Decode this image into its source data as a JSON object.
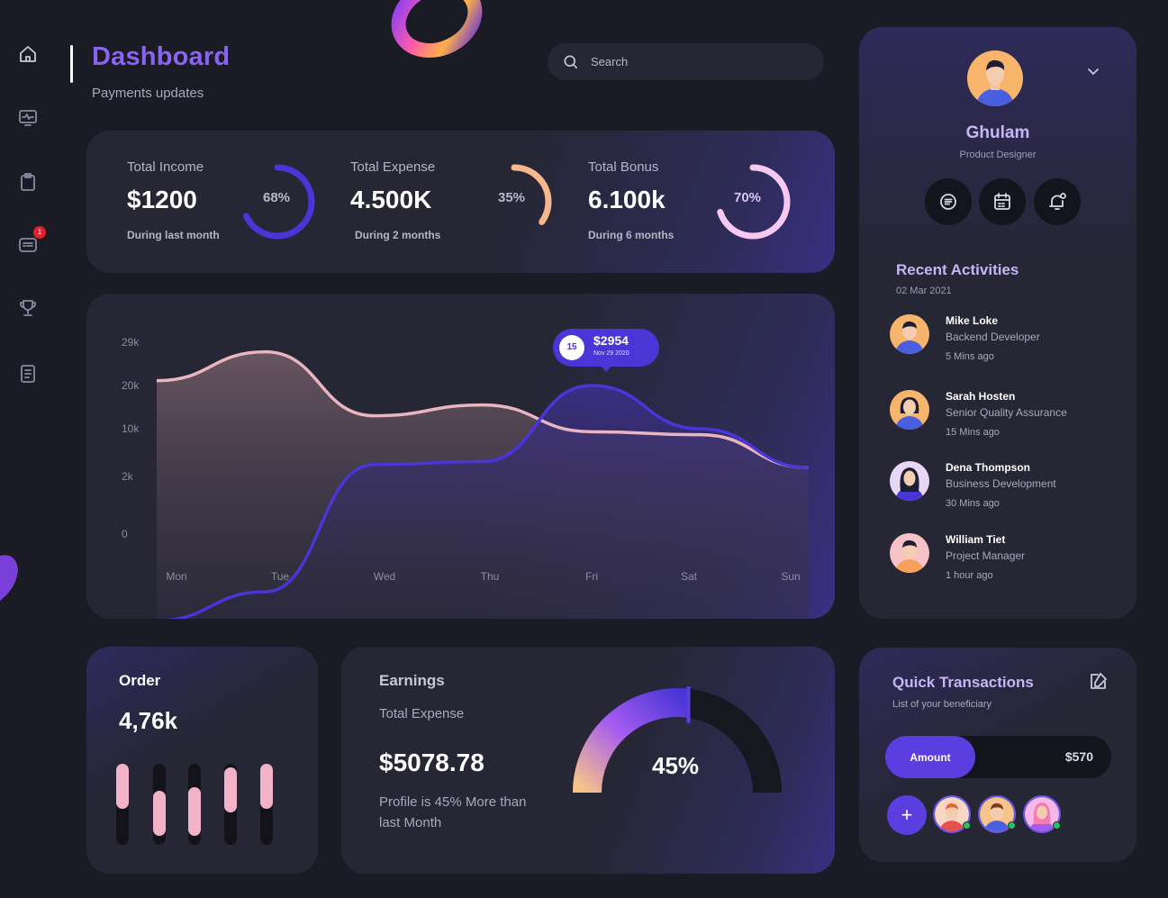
{
  "sidebar": {
    "icons": [
      "home-icon",
      "monitor-icon",
      "clipboard-icon",
      "message-icon",
      "trophy-icon",
      "document-icon"
    ],
    "notification_count": "1"
  },
  "header": {
    "title": "Dashboard",
    "subtitle": "Payments updates"
  },
  "search": {
    "placeholder": "Search"
  },
  "stats": [
    {
      "label": "Total Income",
      "value": "$1200",
      "sub": "During last month",
      "percent_label": "68%",
      "percent": 68,
      "color": "#4a35d6"
    },
    {
      "label": "Total Expense",
      "value": "4.500K",
      "sub": "During 2 months",
      "percent_label": "35%",
      "percent": 35,
      "color": "#f6b78b"
    },
    {
      "label": "Total Bonus",
      "value": "6.100k",
      "sub": "During 6 months",
      "percent_label": "70%",
      "percent": 70,
      "color": "#f7c9f2"
    }
  ],
  "chart_data": {
    "type": "area",
    "categories": [
      "Mon",
      "Tue",
      "Wed",
      "Thu",
      "Fri",
      "Sat",
      "Sun"
    ],
    "y_tick_labels": [
      "0",
      "2k",
      "10k",
      "20k",
      "29k"
    ],
    "series": [
      {
        "color": "#e9b6c0",
        "values": [
          21,
          27,
          13,
          15.5,
          9.5,
          9,
          3.5
        ]
      },
      {
        "color": "#4a35d6",
        "values": [
          -3,
          -2,
          4,
          4.5,
          20,
          10,
          3.5
        ]
      }
    ],
    "tooltip": {
      "day": "15",
      "value": "$2954",
      "date": "Nov 29 2020"
    },
    "grid": false
  },
  "profile": {
    "name": "Ghulam",
    "role": "Product Designer",
    "buttons": [
      "notes-icon",
      "calendar-icon",
      "bell-icon"
    ]
  },
  "recent_activities": {
    "title": "Recent Activities",
    "date": "02 Mar 2021",
    "items": [
      {
        "name": "Mike Loke",
        "role": "Backend Developer",
        "time": "5 Mins ago"
      },
      {
        "name": "Sarah Hosten",
        "role": "Senior Quality Assurance",
        "time": "15 Mins ago"
      },
      {
        "name": "Dena Thompson",
        "role": "Business Development",
        "time": "30 Mins ago"
      },
      {
        "name": "William Tiet",
        "role": "Project Manager",
        "time": "1 hour ago"
      }
    ]
  },
  "order": {
    "title": "Order",
    "value": "4,76k",
    "bars": [
      0.55,
      0.55,
      0.6,
      0.55,
      0.55
    ]
  },
  "earnings": {
    "title": "Earnings",
    "subtitle": "Total Expense",
    "value": "$5078.78",
    "note": "Profile is 45% More than last Month",
    "percent_label": "45%",
    "percent": 45
  },
  "quick_transactions": {
    "title": "Quick Transactions",
    "subtitle": "List of your beneficiary",
    "amount_label": "Amount",
    "amount_value": "$570",
    "add_label": "+"
  },
  "colors": {
    "accent": "#5b3ee0",
    "background": "#1b1b26",
    "card": "#262634"
  }
}
